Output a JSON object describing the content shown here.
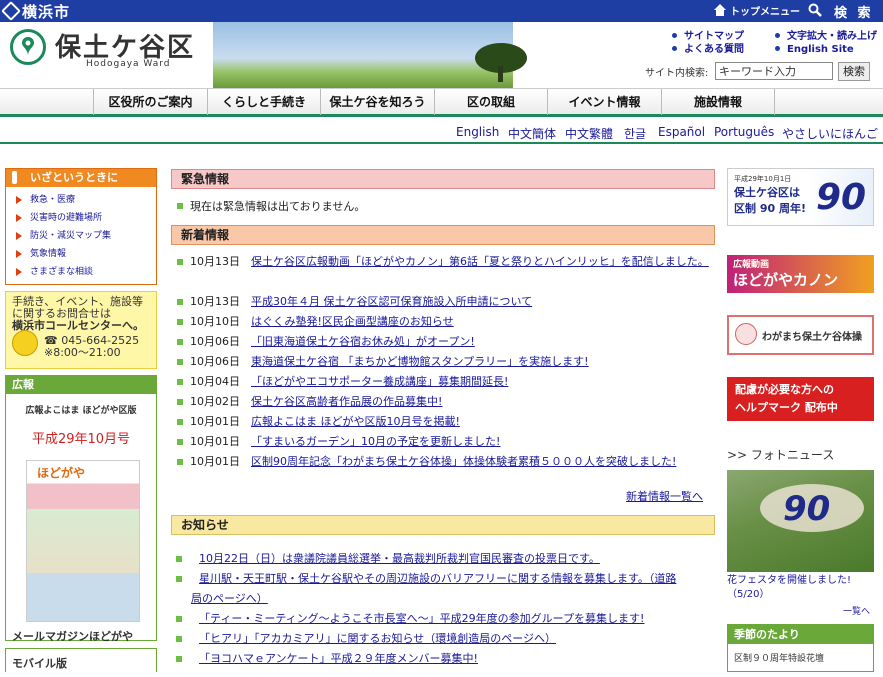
{
  "topbar": {
    "city": "横浜市",
    "top_menu": "トップメニュー",
    "search": "検 索"
  },
  "header": {
    "ward_name": "保土ケ谷区",
    "ward_name_en": "Hodogaya Ward",
    "links": [
      "サイトマップ",
      "よくある質問",
      "文字拡大・読み上げ",
      "English Site"
    ],
    "search_label": "サイト内検索:",
    "search_value": "キーワード入力",
    "search_button": "検索"
  },
  "nav": [
    "区役所のご案内",
    "くらしと手続き",
    "保土ケ谷を知ろう",
    "区の取組",
    "イベント情報",
    "施設情報"
  ],
  "languages": [
    "English",
    "中文簡体",
    "中文繁體",
    "한글",
    "Español",
    "Português",
    "やさしいにほんご"
  ],
  "emergency_box": {
    "title": "いざというときに",
    "items": [
      "救急・医療",
      "災害時の避難場所",
      "防災・減災マップ集",
      "気象情報",
      "さまざまな相談"
    ]
  },
  "call_center": {
    "line1": "手続き、イベント、施設等",
    "line2": "に関するお問合せは",
    "line3": "横浜市コールセンターへ。",
    "tel": "☎ 045-664-2525",
    "hours": "※8:00～21:00"
  },
  "kouhou": {
    "title": "広報",
    "subtitle": "広報よこはま ほどがや区版",
    "issue": "平成29年10月号",
    "cover_title": "ほどがや",
    "mail_magazine": "メールマガジンほどがや"
  },
  "mobile": "モバイル版",
  "sections": {
    "emergency": "緊急情報",
    "news": "新着情報",
    "notice": "お知らせ"
  },
  "emergency_text": "現在は緊急情報は出ておりません。",
  "news": [
    {
      "date": "10月13日",
      "title": "保土ケ谷区広報動画「ほどがやカノン」第6話「夏と祭りとハインリッヒ」を配信しました。"
    },
    {
      "date": "10月13日",
      "title": "平成30年４月 保土ケ谷区認可保育施設入所申請について"
    },
    {
      "date": "10月10日",
      "title": "はぐくみ塾発!区民企画型講座のお知らせ"
    },
    {
      "date": "10月06日",
      "title": "「旧東海道保土ケ谷宿お休み処」がオープン!"
    },
    {
      "date": "10月06日",
      "title": "東海道保土ケ谷宿 「まちかど博物館スタンプラリー」を実施します!"
    },
    {
      "date": "10月04日",
      "title": "「ほどがやエコサポーター養成講座」募集期間延長!"
    },
    {
      "date": "10月02日",
      "title": "保土ケ谷区高齢者作品展の作品募集中!"
    },
    {
      "date": "10月01日",
      "title": "広報よこはま ほどがや区版10月号を掲載!"
    },
    {
      "date": "10月01日",
      "title": "「すまいるガーデン」10月の予定を更新しました!"
    },
    {
      "date": "10月01日",
      "title": "区制90周年記念「わがまち保土ケ谷体操」体操体験者累積５０００人を突破しました!"
    }
  ],
  "news_more": "新着情報一覧へ",
  "notices": [
    "10月22日（日）は衆議院議員総選挙・最高裁判所裁判官国民審査の投票日です。",
    "星川駅・天王町駅・保土ケ谷駅やその周辺施設のバリアフリーに関する情報を募集します。（道路",
    "局のページへ）",
    "「ティー・ミーティング～ようこそ市長室へ～」平成29年度の参加グループを募集します!",
    "「ヒアリ」「アカカミアリ」に関するお知らせ（環境創造局のページへ）",
    "「ヨコハマｅアンケート」平成２９年度メンバー募集中!"
  ],
  "right": {
    "banner90_line1": "平成29年10月1日",
    "banner90_line2": "保土ケ谷区は",
    "banner90_line3": "区制 90 周年!",
    "canon_small": "広報動画",
    "canon": "ほどがやカノン",
    "taisou": "わがまち保土ケ谷体操",
    "help1": "配慮が必要な方への",
    "help2": "ヘルプマーク 配布中",
    "photo_news": ">> フォトニュース",
    "photo_caption1": "花フェスタを開催しました!",
    "photo_caption2": "（5/20）",
    "photo_more": "一覧へ",
    "season_title": "季節のたより",
    "season_text": "区制９０周年特設花壇"
  }
}
